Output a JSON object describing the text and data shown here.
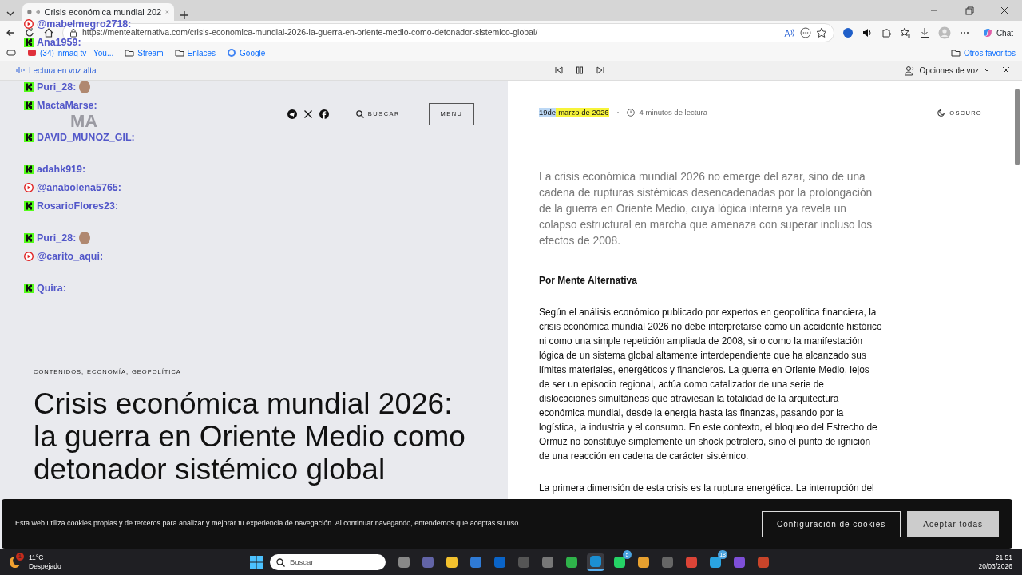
{
  "browser": {
    "tab_title": "Crisis económica mundial 202",
    "url": "https://mentealternativa.com/crisis-economica-mundial-2026-la-guerra-en-oriente-medio-como-detonador-sistemico-global/",
    "bookmarks": [
      "(34) inmaq tv - You...",
      "Stream",
      "Enlaces",
      "Google"
    ],
    "other_favorites": "Otros favoritos",
    "chat_button": "Chat"
  },
  "read_aloud": {
    "label": "Lectura en voz alta",
    "voice_options": "Opciones de voz"
  },
  "chat_overlay": [
    {
      "kind": "youtube",
      "user": "@mabelmegro2718:"
    },
    {
      "kind": "kick",
      "user": "Ana1959:"
    },
    {
      "kind": "kick",
      "user": "Puri_28:",
      "sticker": true
    },
    {
      "kind": "kick",
      "user": "MactaMarse:"
    },
    {
      "kind": "kick",
      "user": "DAVID_MUNOZ_GIL:"
    },
    {
      "kind": "kick",
      "user": "adahk919:"
    },
    {
      "kind": "youtube",
      "user": "@anabolena5765:"
    },
    {
      "kind": "kick",
      "user": "RosarioFlores23:"
    },
    {
      "kind": "kick",
      "user": "Puri_28:",
      "sticker": true
    },
    {
      "kind": "youtube",
      "user": "@carito_aqui:"
    },
    {
      "kind": "kick",
      "user": "Quira:"
    }
  ],
  "site_header": {
    "logo": "MA",
    "search": "BUSCAR",
    "menu": "MENU"
  },
  "hero": {
    "categories": [
      "CONTENIDOS,",
      "ECONOMÍA,",
      "GEOPOLÍTICA"
    ],
    "title": "Crisis económica mundial 2026: la guerra en Oriente Medio como detonador sistémico global"
  },
  "article": {
    "date_parts": [
      {
        "text": "19de",
        "selected": true,
        "highlighted": false
      },
      {
        "text": "marzo de 2026",
        "selected": false,
        "highlighted": true
      }
    ],
    "reading_time": "4 minutos de lectura",
    "theme_toggle": "OSCURO",
    "lead": "La crisis económica mundial 2026 no emerge del azar, sino de una cadena de rupturas sistémicas desencadenadas por la prolongación de la guerra en Oriente Medio, cuya lógica interna ya revela un colapso estructural en marcha que amenaza con superar incluso los efectos de 2008.",
    "author": "Por Mente Alternativa",
    "paragraphs": [
      "Según el análisis económico publicado por expertos en geopolítica financiera, la crisis económica mundial 2026 no debe interpretarse como un accidente histórico ni como una simple repetición ampliada de 2008, sino como la manifestación lógica de un sistema global altamente interdependiente que ha alcanzado sus límites materiales, energéticos y financieros. La guerra en Oriente Medio, lejos de ser un episodio regional, actúa como catalizador de una serie de dislocaciones simultáneas que atraviesan la totalidad de la arquitectura económica mundial, desde la energía hasta las finanzas, pasando por la logística, la industria y el consumo. En este contexto, el bloqueo del Estrecho de Ormuz no constituye simplemente un shock petrolero, sino el punto de ignición de una reacción en cadena de carácter sistémico.",
      "La primera dimensión de esta crisis es la ruptura energética. La interrupción del"
    ]
  },
  "cookie_banner": {
    "text": "Esta web utiliza cookies propias y de terceros para analizar y mejorar tu experiencia de navegación. Al continuar navegando, entendemos que aceptas su uso.",
    "settings_button": "Configuración de cookies",
    "accept_button": "Aceptar todas"
  },
  "taskbar": {
    "weather_badge": "1",
    "temperature": "11°C",
    "condition": "Despejado",
    "search_placeholder": "Buscar",
    "apps": [
      {
        "selected": false
      },
      {
        "selected": false
      },
      {
        "selected": false
      },
      {
        "selected": false
      },
      {
        "selected": false
      },
      {
        "selected": false
      },
      {
        "selected": false
      },
      {
        "selected": false
      },
      {
        "selected": true
      },
      {
        "selected": false,
        "badge": "5"
      },
      {
        "selected": false
      },
      {
        "selected": false
      },
      {
        "selected": false
      },
      {
        "selected": false,
        "badge": "18"
      },
      {
        "selected": false
      },
      {
        "selected": false
      }
    ],
    "time": "21:51",
    "date": "20/03/2026"
  }
}
